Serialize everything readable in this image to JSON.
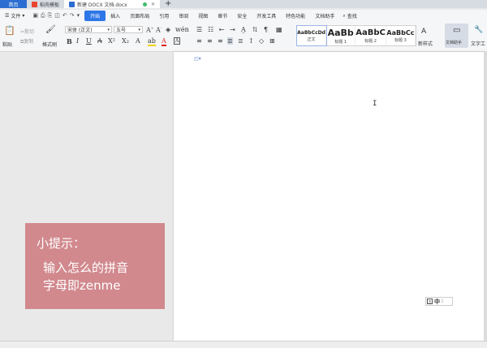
{
  "tabs": {
    "home": "首页",
    "template": "稻壳模板",
    "document": "新建 DOCX 文档.docx",
    "add": "+"
  },
  "menu": {
    "file": "文件",
    "items": [
      "开始",
      "插入",
      "页面布局",
      "引用",
      "审阅",
      "视图",
      "章节",
      "安全",
      "开发工具",
      "特色功能",
      "文档助手"
    ],
    "search": "查找"
  },
  "ribbon": {
    "paste": "粘贴",
    "cut": "剪切",
    "copy": "复制",
    "format_painter": "格式刷",
    "font_name": "宋体 (正文)",
    "font_size": "五号",
    "styles": [
      {
        "sample": "AaBbCcDd",
        "name": "正文"
      },
      {
        "sample": "AaBb",
        "name": "标题 1"
      },
      {
        "sample": "AaBbC",
        "name": "标题 2"
      },
      {
        "sample": "AaBbCc",
        "name": "标题 3"
      }
    ],
    "new_style": "新样式",
    "doc_helper": "文档助手",
    "text_tools": "文字工"
  },
  "tip": {
    "title": "小提示：",
    "line1": "输入怎么的拼音",
    "line2": "字母即zenme"
  },
  "ime": {
    "mode": "中"
  },
  "colors": {
    "accent": "#2e77e8",
    "tip_bg": "#d1898e"
  }
}
